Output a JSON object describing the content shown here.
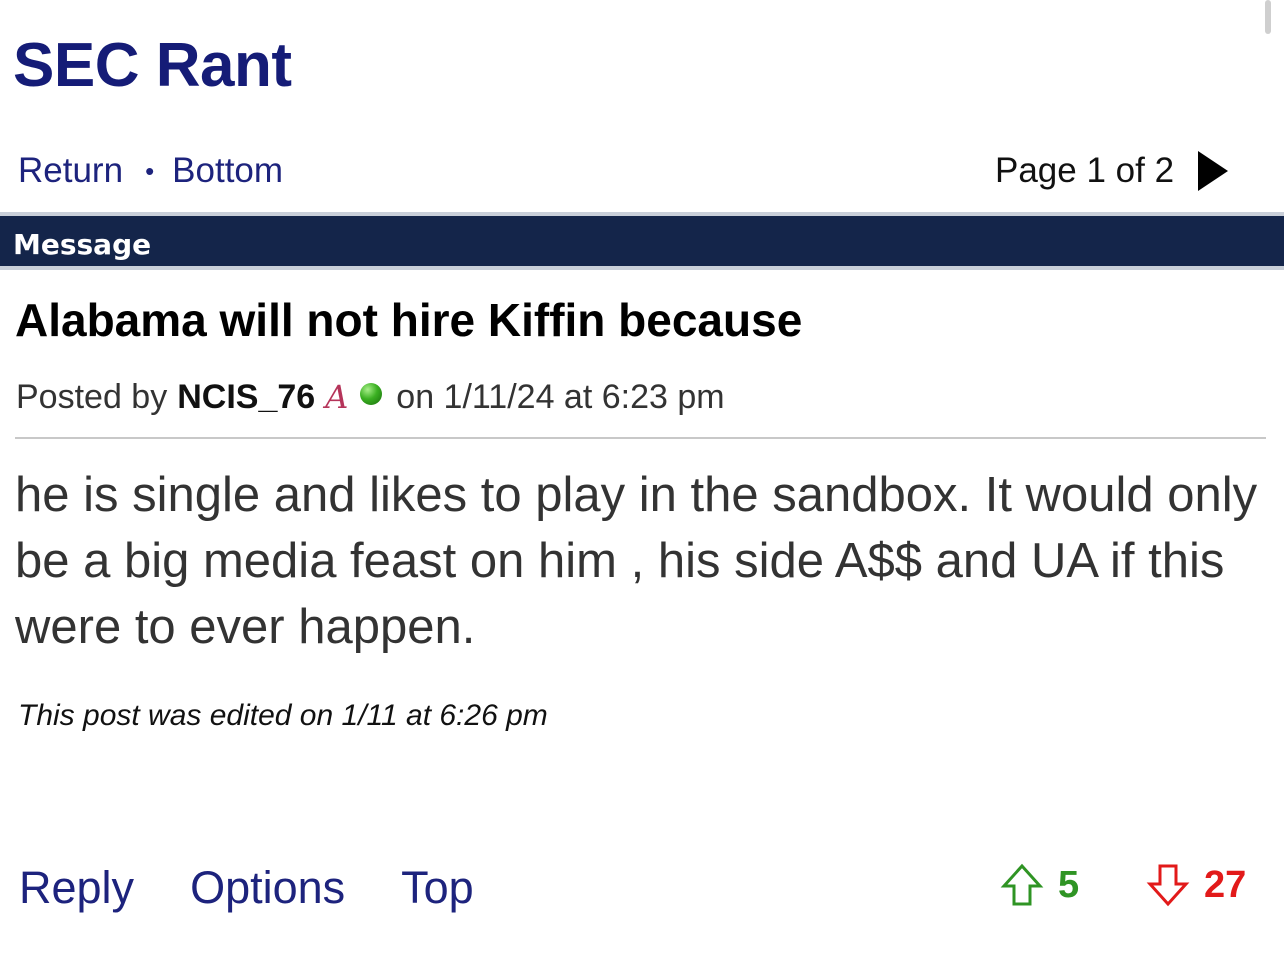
{
  "board": {
    "title": "SEC Rant"
  },
  "nav": {
    "return_label": "Return",
    "separator": "•",
    "bottom_label": "Bottom"
  },
  "pager": {
    "label": "Page 1 of 2",
    "next_icon": "play-right-icon"
  },
  "header": {
    "label": "Message"
  },
  "post": {
    "title": "Alabama will not hire Kiffin because",
    "posted_by_label": "Posted by",
    "author": "NCIS_76",
    "team_logo": "A",
    "status_icon": "online-status-icon",
    "timestamp": "on 1/11/24 at 6:23 pm",
    "body": "he is single and likes to play in the sandbox. It would only be a big media feast on him , his side A$$ and UA if this were to ever happen.",
    "edited_note": "This post was edited on 1/11 at 6:26 pm"
  },
  "actions": {
    "reply": "Reply",
    "options": "Options",
    "top": "Top"
  },
  "votes": {
    "up_count": "5",
    "down_count": "27",
    "up_color": "#2f9424",
    "down_color": "#e21a1a"
  },
  "colors": {
    "link": "#1d237d",
    "title": "#151c77",
    "header_bar": "#14254a"
  }
}
